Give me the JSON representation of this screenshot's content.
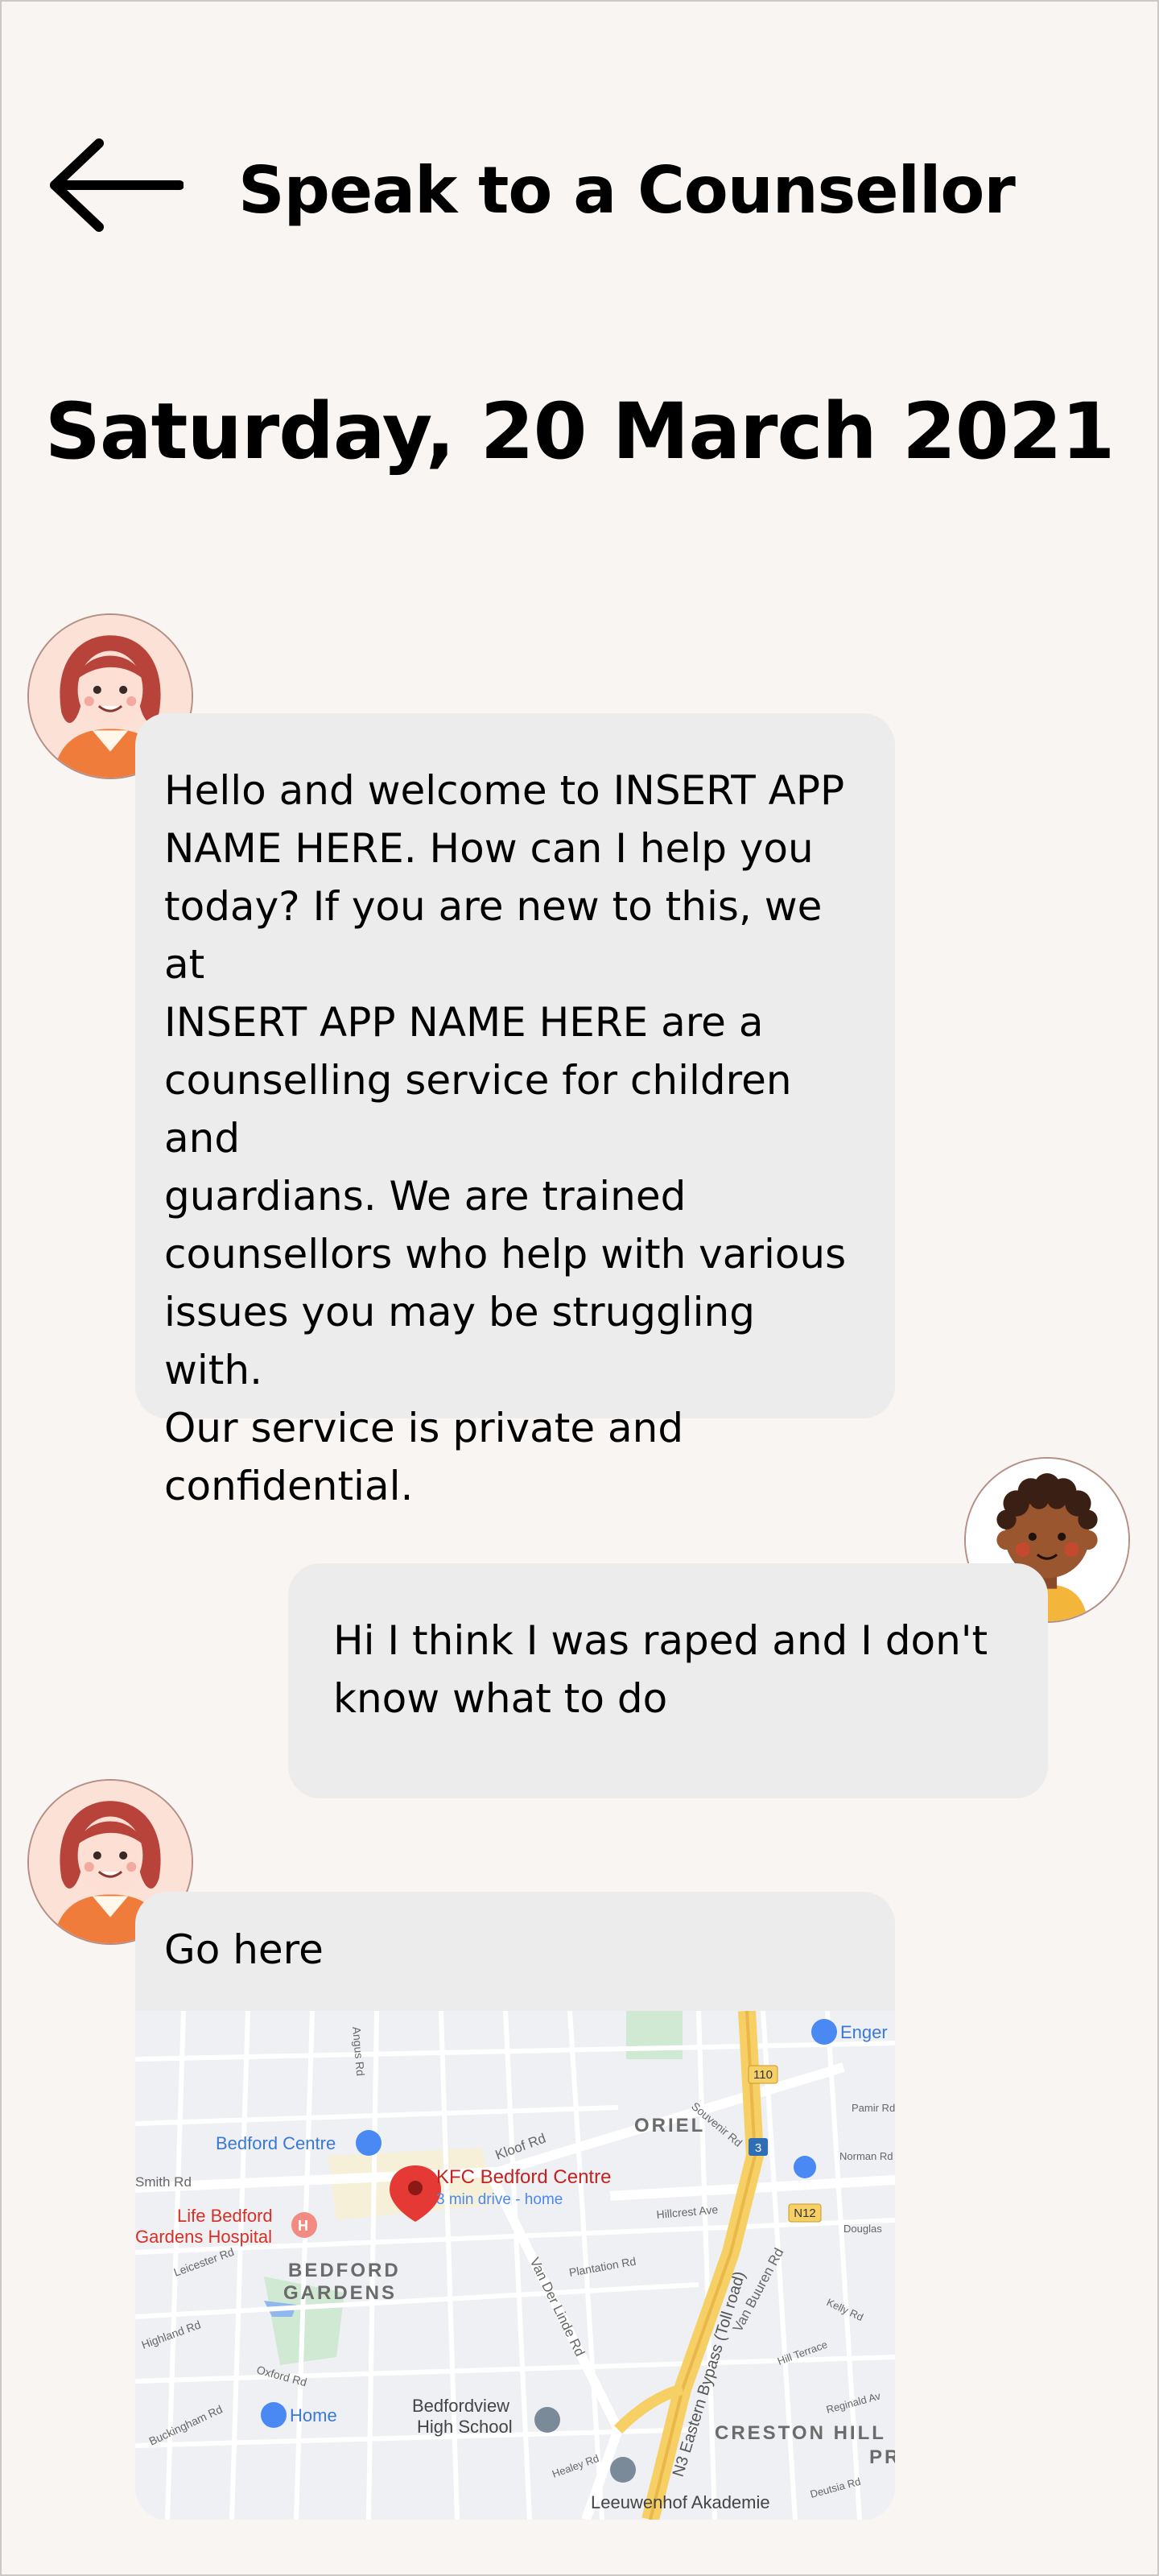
{
  "header": {
    "title": "Speak to a Counsellor",
    "back_icon": "arrow-left-icon"
  },
  "date_label": "Saturday, 20 March 2021",
  "messages": [
    {
      "sender": "counsellor",
      "avatar": "counsellor-avatar",
      "text": "Hello and welcome to INSERT APP\nNAME HERE. How can I help you\ntoday? If you are new to this, we at\nINSERT APP NAME HERE are a\ncounselling service for children and\nguardians. We are trained\ncounsellors who help with various\nissues you may be struggling with.\nOur service is private and\nconfidential."
    },
    {
      "sender": "user",
      "avatar": "user-avatar",
      "text": "Hi I think I was raped and I don't\nknow what to do"
    },
    {
      "sender": "counsellor",
      "avatar": "counsellor-avatar",
      "text": "Go here"
    }
  ],
  "map": {
    "pin_title": "KFC Bedford Centre",
    "pin_subtitle": "3 min drive - home",
    "labels": {
      "bedford_centre": "Bedford Centre",
      "life_bedford": "Life Bedford",
      "gardens_hospital": "Gardens Hospital",
      "bedford_gardens_1": "BEDFORD",
      "bedford_gardens_2": "GARDENS",
      "oriel": "ORIEL",
      "creston_hill": "CRESTON HILL",
      "home": "Home",
      "bedfordview_hs_1": "Bedfordview",
      "bedfordview_hs_2": "High School",
      "leeuwenhof": "Leeuwenhof Akademie",
      "enger": "Enger",
      "smith_rd": "Smith Rd",
      "kloof_rd": "Kloof Rd",
      "van_der_linde": "Van Der Linde Rd",
      "n3_bypass": "N3 Eastern Bypass (Toll road)",
      "van_buuren": "Van Buuren Rd",
      "plantation": "Plantation Rd",
      "hillcrest": "Hillcrest Ave",
      "leicester": "Leicester Rd",
      "highland": "Highland Rd",
      "oxford": "Oxford Rd",
      "buckingham": "Buckingham Rd",
      "angus": "Angus Rd",
      "souvenir": "Souvenir Rd",
      "pamir": "Pamir Rd",
      "norman": "Norman Rd",
      "douglas": "Douglas",
      "kelly": "Kelly Rd",
      "hill_terrace": "Hill Terrace",
      "reginald": "Reginald Av",
      "deutsia": "Deutsia Rd",
      "healey": "Healey Rd",
      "pr": "PR",
      "shield_110": "110",
      "shield_3": "3",
      "shield_n12": "N12"
    }
  },
  "colors": {
    "background": "#f9f5f2",
    "bubble": "#ececec",
    "pin": "#e53935",
    "pin_text": "#c5221f",
    "poi_blue": "#4a89f3",
    "highway": "#f6cf65"
  }
}
